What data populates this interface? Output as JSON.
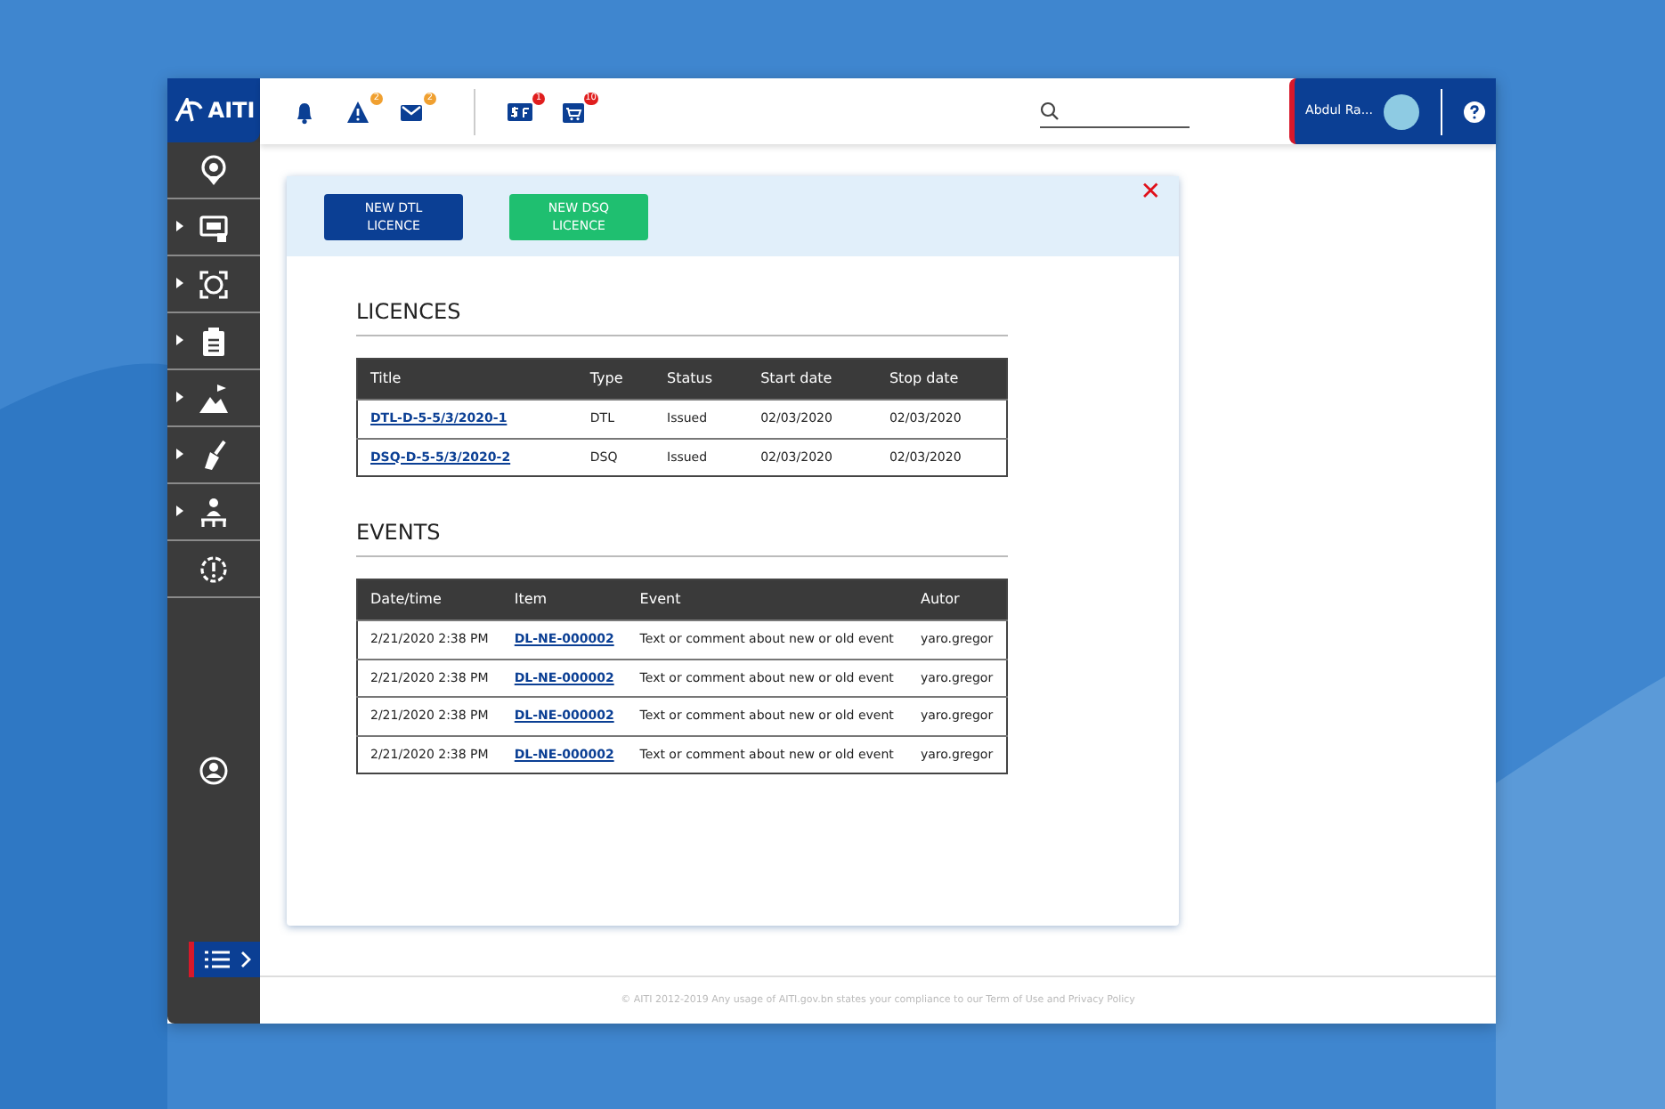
{
  "logo": {
    "text": "AITI"
  },
  "topbar": {
    "icons": [
      {
        "kind": "bell"
      },
      {
        "kind": "warning",
        "badge": "2",
        "color": "#f0a030"
      },
      {
        "kind": "mail",
        "badge": "2",
        "color": "#f0a030"
      },
      {
        "kind": "divider"
      },
      {
        "kind": "finance",
        "badge": "1",
        "color": "#e01e1e"
      },
      {
        "kind": "cart",
        "badge": "10",
        "color": "#e01e1e"
      }
    ],
    "user": {
      "name": "Abdul Ra..."
    }
  },
  "sidebar": {
    "items": [
      {
        "expandable": false
      },
      {
        "expandable": true
      },
      {
        "expandable": true
      },
      {
        "expandable": true
      },
      {
        "expandable": true
      },
      {
        "expandable": true
      },
      {
        "expandable": true
      },
      {
        "expandable": false
      }
    ]
  },
  "panel": {
    "close": "✕",
    "buttons": [
      {
        "label": "NEW DTL LICENCE",
        "kind": "primary"
      },
      {
        "label": "NEW DSQ LICENCE",
        "kind": "success"
      }
    ],
    "licences": {
      "title": "LICENCES",
      "columns": [
        "Title",
        "Type",
        "Status",
        "Start date",
        "Stop date"
      ],
      "rows": [
        [
          "DTL-D-5-5/3/2020-1",
          "DTL",
          "Issued",
          "02/03/2020",
          "02/03/2020"
        ],
        [
          "DSQ-D-5-5/3/2020-2",
          "DSQ",
          "Issued",
          "02/03/2020",
          "02/03/2020"
        ]
      ]
    },
    "events": {
      "title": "EVENTS",
      "columns": [
        "Date/time",
        "Item",
        "Event",
        "Autor"
      ],
      "rows": [
        [
          "2/21/2020 2:38 PM",
          "DL-NE-000002",
          "Text or comment about new or old event",
          "yaro.gregor"
        ],
        [
          "2/21/2020 2:38 PM",
          "DL-NE-000002",
          "Text or comment about new or old event",
          "yaro.gregor"
        ],
        [
          "2/21/2020 2:38 PM",
          "DL-NE-000002",
          "Text or comment about new or old event",
          "yaro.gregor"
        ],
        [
          "2/21/2020 2:38 PM",
          "DL-NE-000002",
          "Text or comment about new or old event",
          "yaro.gregor"
        ]
      ]
    }
  },
  "footer": {
    "text": "© AITI 2012-2019 Any usage of AITI.gov.bn states your compliance to our Term of Use and Privacy Policy"
  }
}
